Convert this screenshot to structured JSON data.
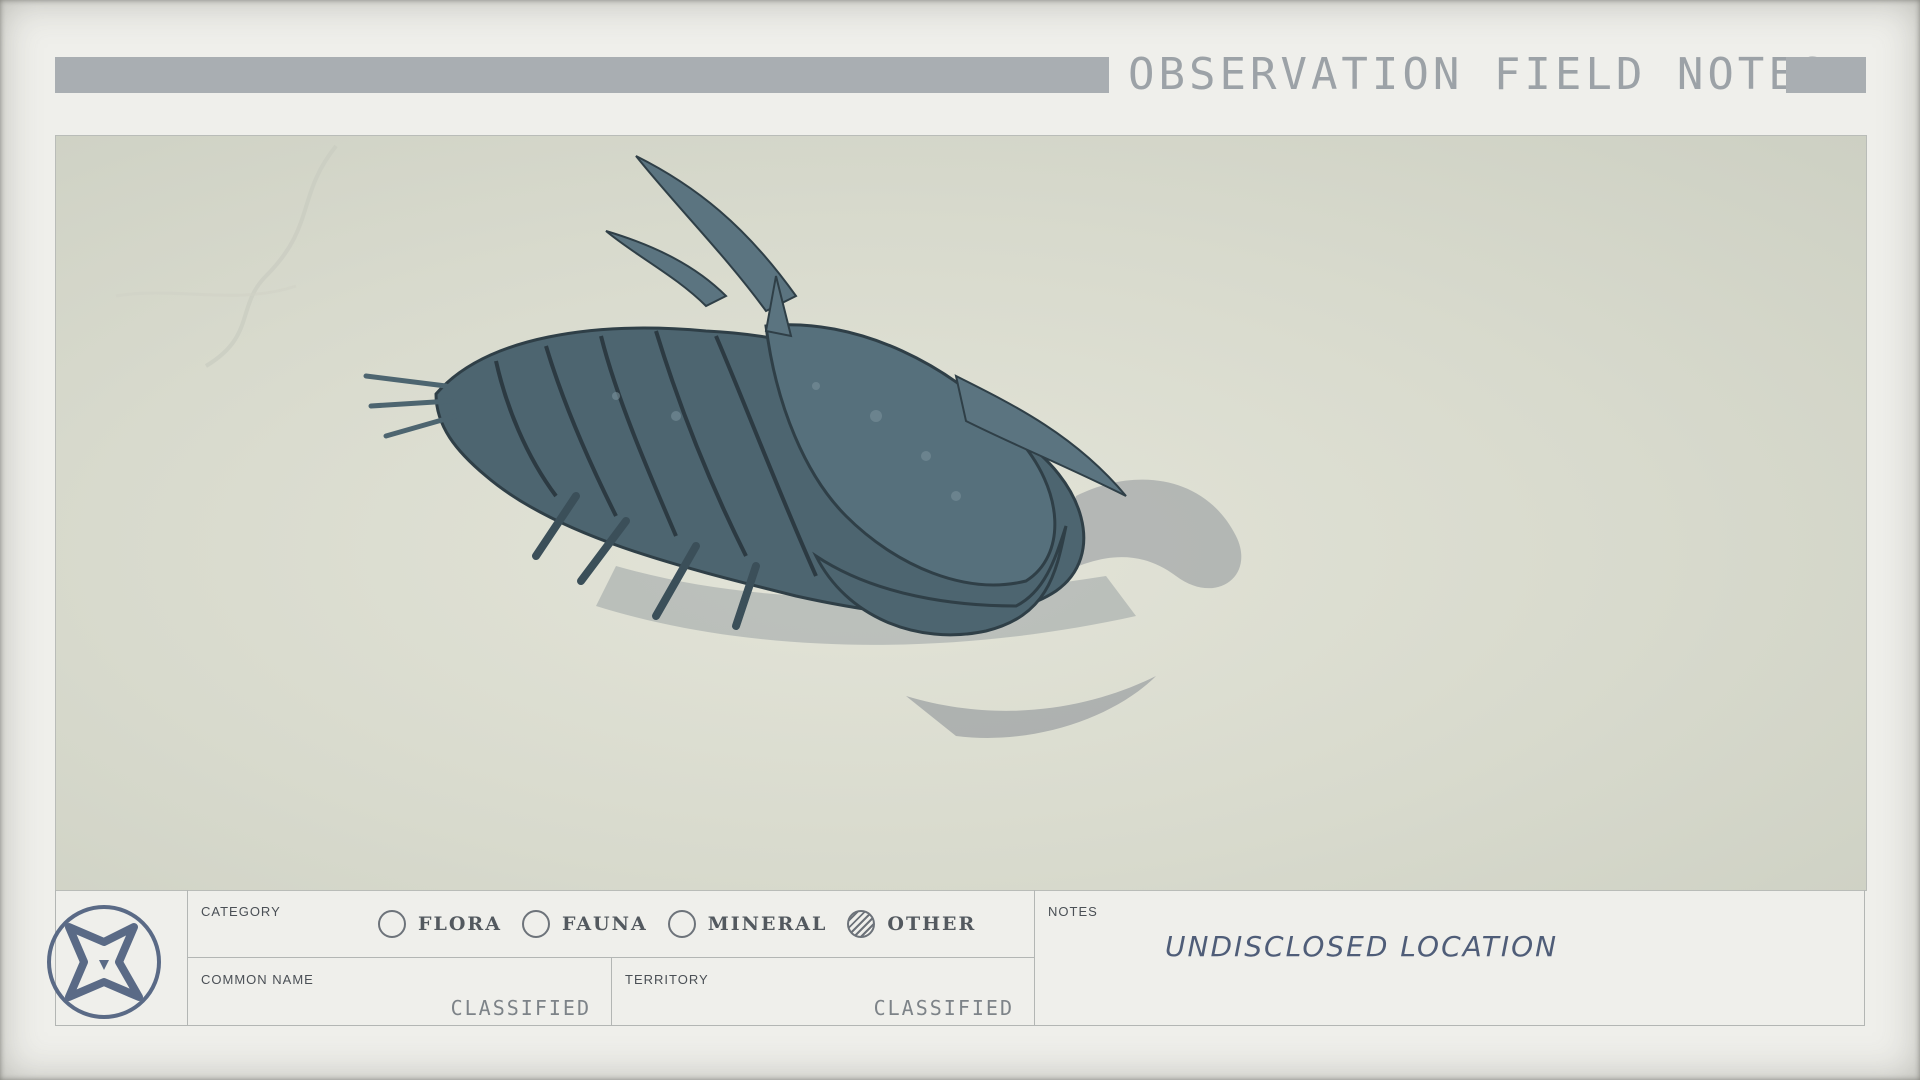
{
  "header": {
    "title": "OBSERVATION FIELD NOTES"
  },
  "photo": {
    "icon": "armored-creature-photo"
  },
  "category": {
    "label": "CATEGORY",
    "options": [
      {
        "label": "FLORA",
        "selected": false
      },
      {
        "label": "FAUNA",
        "selected": false
      },
      {
        "label": "MINERAL",
        "selected": false
      },
      {
        "label": "OTHER",
        "selected": true
      }
    ]
  },
  "common_name": {
    "label": "COMMON NAME",
    "value": "CLASSIFIED"
  },
  "territory": {
    "label": "TERRITORY",
    "value": "CLASSIFIED"
  },
  "notes": {
    "label": "NOTES",
    "value": "UNDISCLOSED LOCATION"
  },
  "logo": {
    "icon": "star-emblem-icon"
  },
  "colors": {
    "paper": "#efefeb",
    "header_bar": "#a9aeb2",
    "ink_blue": "#4f5d78"
  }
}
